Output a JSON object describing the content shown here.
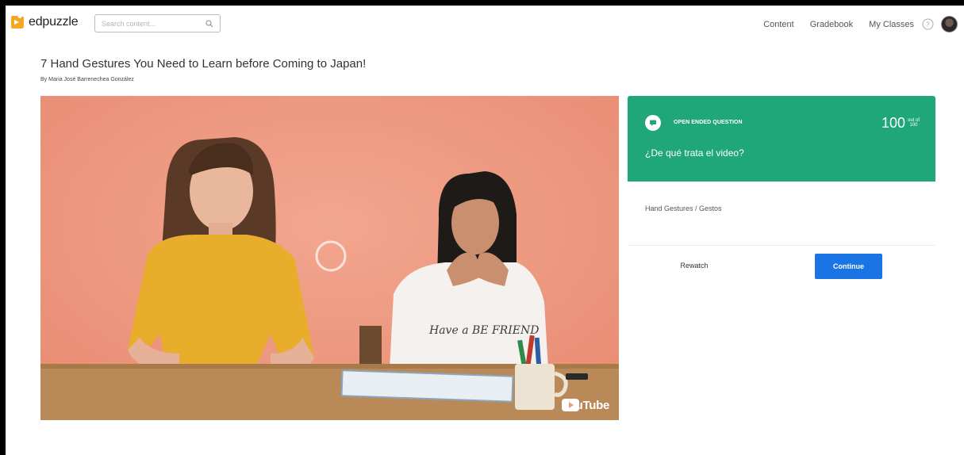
{
  "app": {
    "brand": "edpuzzle",
    "brand_color": "#f5a623"
  },
  "search": {
    "placeholder": "Search content..."
  },
  "nav": {
    "content": "Content",
    "gradebook": "Gradebook",
    "my_classes": "My Classes"
  },
  "icons": {
    "search": "search-icon",
    "help": "help-circle-icon",
    "question": "chat-bubble-icon",
    "youtube": "youtube-icon"
  },
  "video": {
    "title": "7 Hand Gestures You Need to Learn before Coming to Japan!",
    "author": "By Maria José Barrenechea González",
    "shirt_text": "Have a BE FRIEND",
    "watermark": "YouTube"
  },
  "question": {
    "type": "OPEN ENDED QUESTION",
    "points": "100",
    "out_of": "out of",
    "max": "100",
    "text": "¿De qué trata el video?",
    "color": "#1fa77a"
  },
  "answer": {
    "text": "Hand Gestures / Gestos"
  },
  "actions": {
    "rewatch": "Rewatch",
    "continue": "Continue",
    "continue_color": "#1b74e4"
  }
}
